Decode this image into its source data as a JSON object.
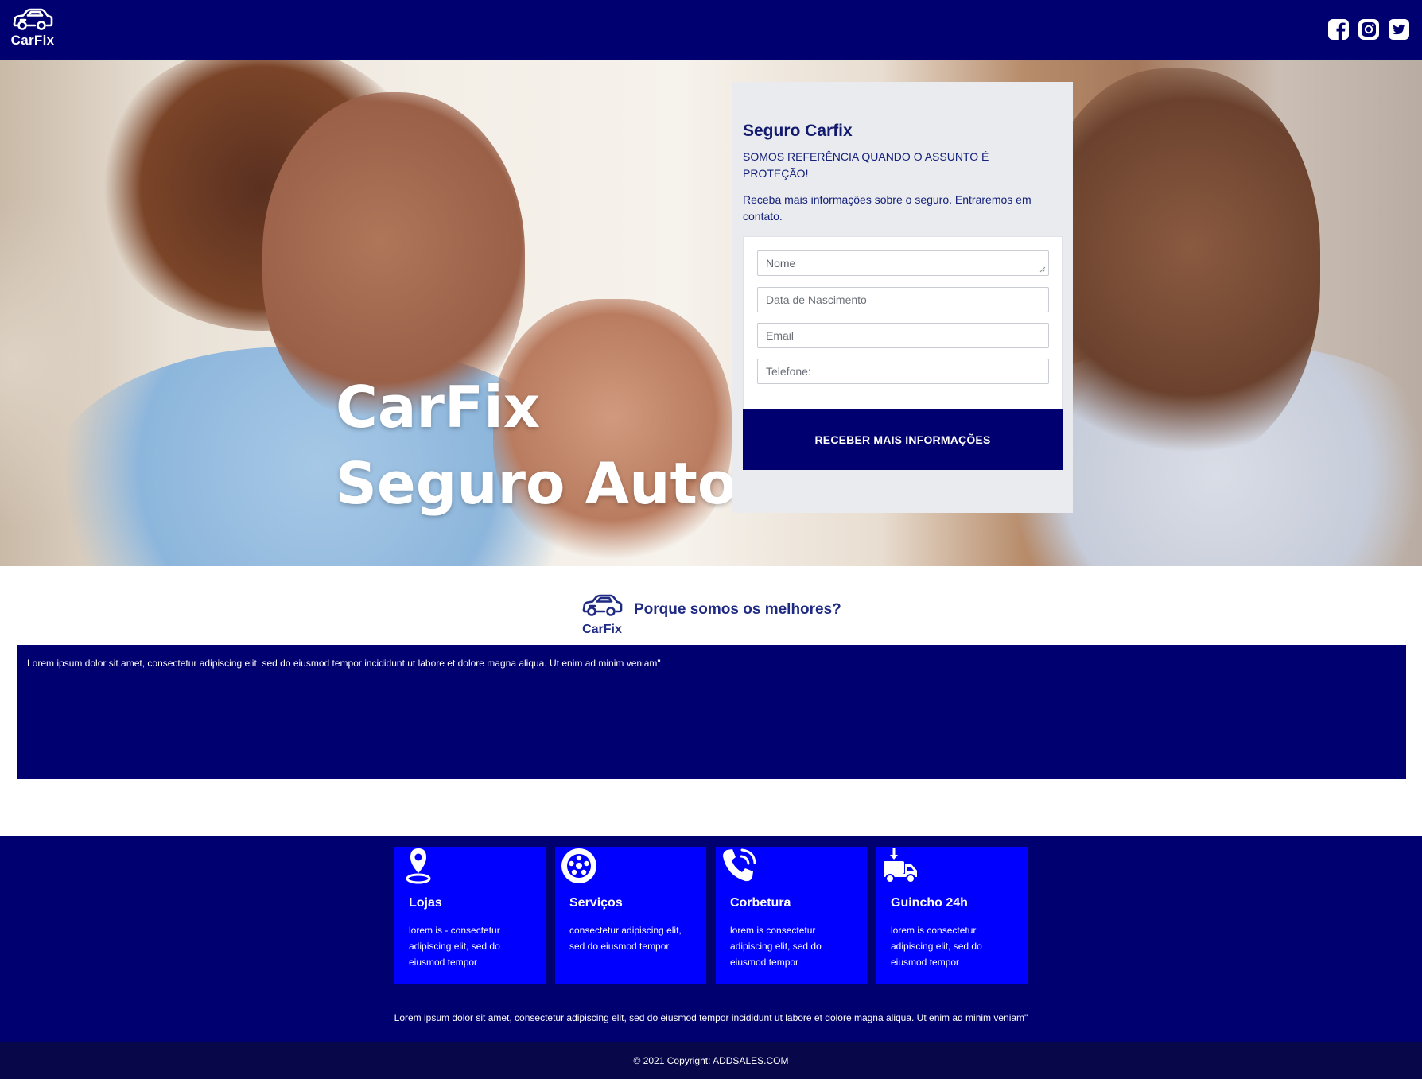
{
  "nav": {
    "logo_text": "CarFix",
    "social": [
      "facebook-icon",
      "instagram-icon",
      "twitter-icon"
    ]
  },
  "hero": {
    "title_line1": "CarFix",
    "title_line2": "Seguro Auto"
  },
  "form": {
    "title": "Seguro Carfix",
    "subtitle": "SOMOS REFERÊNCIA QUANDO O ASSUNTO É PROTEÇÃO!",
    "description": "Receba mais informações sobre o seguro. Entraremos em contato.",
    "name_placeholder": "Nome",
    "birth_placeholder": "Data de Nascimento",
    "email_placeholder": "Email",
    "phone_placeholder": "Telefone:",
    "submit_label": "RECEBER MAIS INFORMAÇÕES"
  },
  "why": {
    "logo_text": "CarFix",
    "title": "Porque somos os melhores?",
    "text": "Lorem ipsum dolor sit amet, consectetur adipiscing elit, sed do eiusmod tempor incididunt ut labore et dolore magna aliqua. Ut enim ad minim veniam\""
  },
  "features": {
    "items": [
      {
        "icon": "location-pin-icon",
        "title": "Lojas",
        "text": "lorem is - consectetur adipiscing elit, sed do eiusmod tempor"
      },
      {
        "icon": "wheel-icon",
        "title": "Serviços",
        "text": "consectetur adipiscing elit, sed do eiusmod tempor"
      },
      {
        "icon": "phone-icon",
        "title": "Corbetura",
        "text": "lorem is consectetur adipiscing elit, sed do eiusmod tempor"
      },
      {
        "icon": "tow-truck-icon",
        "title": "Guincho 24h",
        "text": "lorem is consectetur adipiscing elit, sed do eiusmod tempor"
      }
    ],
    "text": "Lorem ipsum dolor sit amet, consectetur adipiscing elit, sed do eiusmod tempor incididunt ut labore et dolore magna aliqua. Ut enim ad minim veniam\""
  },
  "footer": {
    "copyright": "© 2021 Copyright: ADDSALES.COM"
  },
  "colors": {
    "navy": "#010070",
    "blue": "#0000ff",
    "footer": "#07074a",
    "card": "#e9ebef"
  }
}
